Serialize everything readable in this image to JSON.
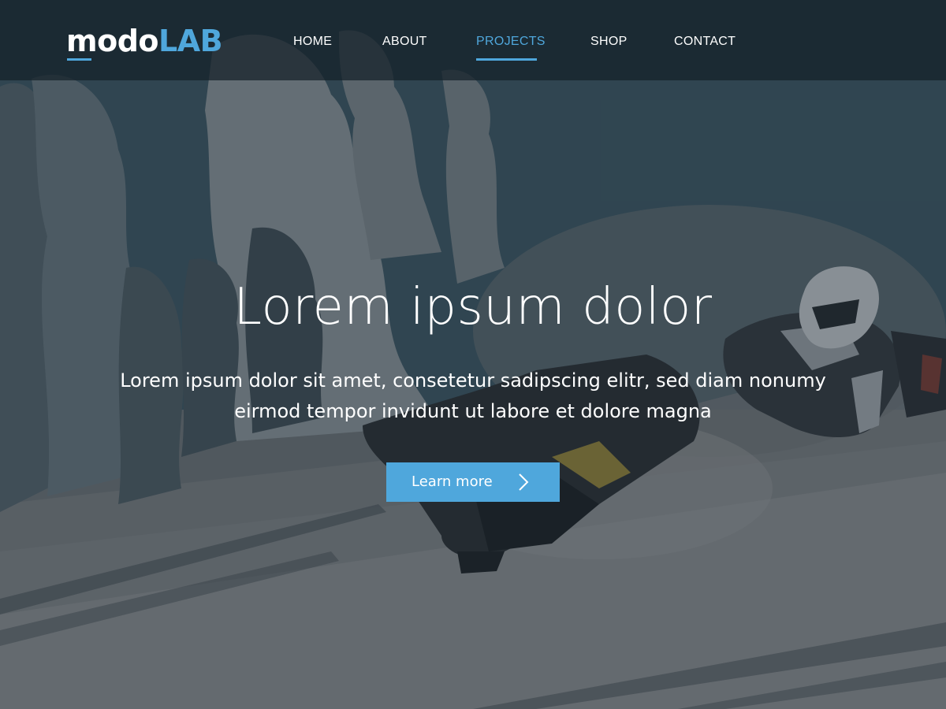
{
  "brand": {
    "name_part1": "modo",
    "name_part2": "LAB"
  },
  "nav": {
    "items": [
      {
        "label": "HOME"
      },
      {
        "label": "ABOUT"
      },
      {
        "label": "PROJECTS"
      },
      {
        "label": "SHOP"
      },
      {
        "label": "CONTACT"
      }
    ],
    "active_item": "PROJECTS"
  },
  "hero": {
    "headline": "Lorem ipsum dolor",
    "subtext": "Lorem ipsum dolor sit amet, consetetur sadipscing elitr, sed diam nonumy eirmod tempor invidunt ut labore et dolore magna",
    "cta_label": "Learn more",
    "cta_icon": "chevron-right-icon",
    "background_image": "snowmobile rider in deep snow"
  },
  "colors": {
    "accent": "#4fa7dc",
    "nav_text": "#ffffff",
    "navbar_bg": "#142028"
  }
}
